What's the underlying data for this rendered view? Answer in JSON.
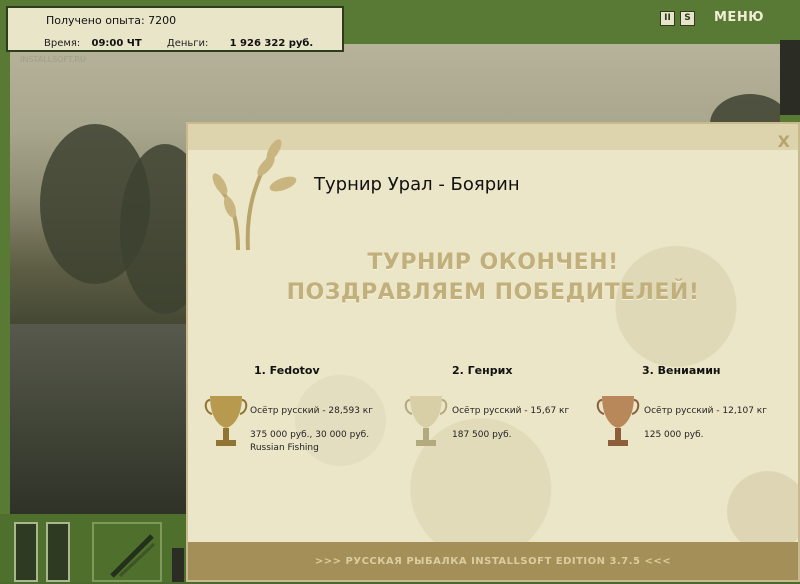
{
  "hud": {
    "xp_text": "Получено опыта: 7200",
    "time_label": "Время:",
    "time_value": "09:00 ЧТ",
    "money_label": "Деньги:",
    "money_value": "1 926 322 руб.",
    "menu_label": "МЕНЮ",
    "pause_icon": "II",
    "s_icon": "S",
    "watermark": "INSTALLSOFT.RU"
  },
  "dialog": {
    "close_label": "X",
    "title": "Турнир Урал - Боярин",
    "congrats_line1": "ТУРНИР ОКОНЧЕН!",
    "congrats_line2": "ПОЗДРАВЛЯЕМ ПОБЕДИТЕЛЕЙ!",
    "winners": [
      {
        "name": "1. Fedotov",
        "fish": "Осётр русский - 28,593 кг",
        "prize": "375 000 руб., 30 000 руб.",
        "sponsor": "Russian Fishing",
        "cup_color": "#b79a4e"
      },
      {
        "name": "2. Генрих",
        "fish": "Осётр русский - 15,67 кг",
        "prize": "187 500 руб.",
        "sponsor": "",
        "cup_color": "#d8cfa7"
      },
      {
        "name": "3. Вениамин",
        "fish": "Осётр русский - 12,107 кг",
        "prize": "125 000 руб.",
        "sponsor": "",
        "cup_color": "#b8875a"
      }
    ],
    "footer": ">>> РУССКАЯ РЫБАЛКА INSTALLSOFT EDITION 3.7.5 <<<"
  }
}
